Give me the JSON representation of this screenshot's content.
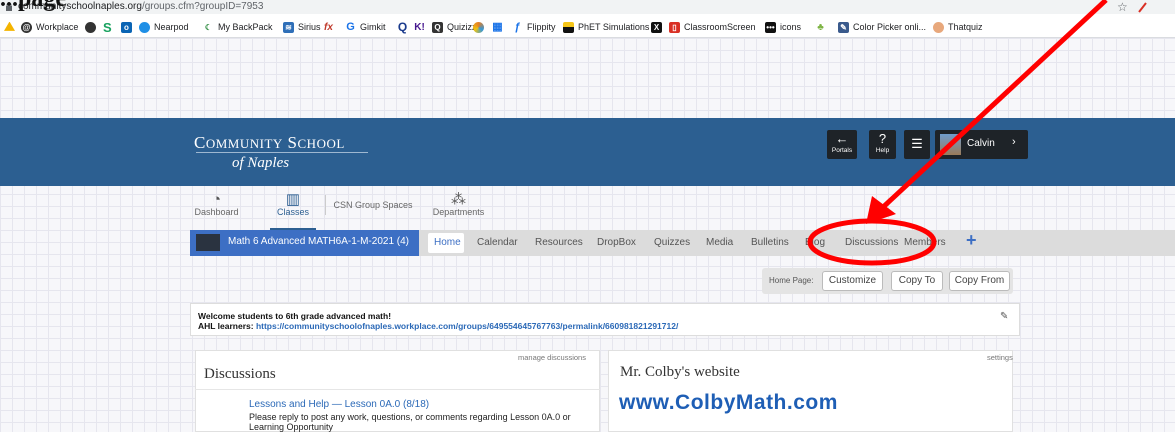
{
  "document": {
    "title_fragment": "...page"
  },
  "browser": {
    "url_domain": "communityschoolnaples.org",
    "url_path": "/groups.cfm?groupID=7953",
    "bookmarks": [
      {
        "label": "",
        "icon": "google-drive-icon",
        "color": "#f4b400"
      },
      {
        "label": "Workplace",
        "icon": "workplace-icon",
        "color": "#333333"
      },
      {
        "label": "",
        "icon": "dark-circle-icon",
        "color": "#333333"
      },
      {
        "label": "S",
        "icon": "s-letter-icon",
        "color": "#1aa260"
      },
      {
        "label": "",
        "icon": "outlook-icon",
        "color": "#0a64b4"
      },
      {
        "label": "Nearpod",
        "icon": "nearpod-icon",
        "color": "#1f8fe6"
      },
      {
        "label": "My BackPack",
        "icon": "backpack-icon",
        "color": "#2b8a3e"
      },
      {
        "label": "Sirius",
        "icon": "sirius-icon",
        "color": "#2f6fb8"
      },
      {
        "label": "Sirius",
        "icon": "fx-icon",
        "color": "#c0392b"
      },
      {
        "label": "Gimkit",
        "icon": "gimkit-icon",
        "color": "#1a73e8"
      },
      {
        "label": "",
        "icon": "q-icon",
        "color": "#1a3a8c"
      },
      {
        "label": "",
        "icon": "kahoot-icon",
        "color": "#46178f"
      },
      {
        "label": "Quizizz",
        "icon": "quizizz-icon",
        "color": "#333333"
      },
      {
        "label": "",
        "icon": "colorful-face-icon",
        "color": "#e67e22"
      },
      {
        "label": "",
        "icon": "calendar-grid-icon",
        "color": "#1a73e8"
      },
      {
        "label": "Flippity",
        "icon": "flippity-icon",
        "color": "#1a73e8"
      },
      {
        "label": "PhET Simulations",
        "icon": "phet-icon",
        "color": "#111111"
      },
      {
        "label": "",
        "icon": "x-box-icon",
        "color": "#111111"
      },
      {
        "label": "ClassroomScreen",
        "icon": "classroomscreen-icon",
        "color": "#d93025"
      },
      {
        "label": "icons",
        "icon": "icons-dots-icon",
        "color": "#111111"
      },
      {
        "label": "",
        "icon": "plant-icon",
        "color": "#7cb342"
      },
      {
        "label": "Color Picker onli...",
        "icon": "color-picker-icon",
        "color": "#3a5a8c"
      },
      {
        "label": "Thatquiz",
        "icon": "thatquiz-icon",
        "color": "#e8a87c"
      }
    ]
  },
  "header": {
    "logo_line1_c": "C",
    "logo_line1_a": "OMMUNITY",
    "logo_line1_s": "S",
    "logo_line1_b": "CHOOL",
    "logo_line2": "of Naples",
    "portals_label": "Portals",
    "help_label": "Help",
    "user_name": "Calvin"
  },
  "nav": {
    "dashboard": "Dashboard",
    "classes": "Classes",
    "csn": "CSN Group Spaces",
    "departments": "Departments"
  },
  "classbar": {
    "class_name": "Math 6 Advanced MATH6A-1-M-2021 (4)",
    "tabs": [
      "Home",
      "Calendar",
      "Resources",
      "DropBox",
      "Quizzes",
      "Media",
      "Bulletins",
      "Blog",
      "Discussions",
      "Members"
    ]
  },
  "homepage": {
    "label": "Home Page:",
    "customize": "Customize",
    "copy_to": "Copy To",
    "copy_from": "Copy From"
  },
  "welcome": {
    "line1": "Welcome students to 6th grade advanced math!",
    "line2_prefix": "AHL learners: ",
    "line2_link": "https://communityschoolofnaples.workplace.com/groups/649554645767763/permalink/660981821291712/"
  },
  "discussions": {
    "manage": "manage discussions",
    "title": "Discussions",
    "link": "Lessons and Help — Lesson 0A.0 (8/18)",
    "desc": "Please reply to post any work, questions, or comments regarding Lesson 0A.0 or Learning Opportunity"
  },
  "website": {
    "settings": "settings",
    "title": "Mr. Colby's website",
    "link": "www.ColbyMath.com"
  },
  "annotation": {
    "color": "#ff0000"
  }
}
